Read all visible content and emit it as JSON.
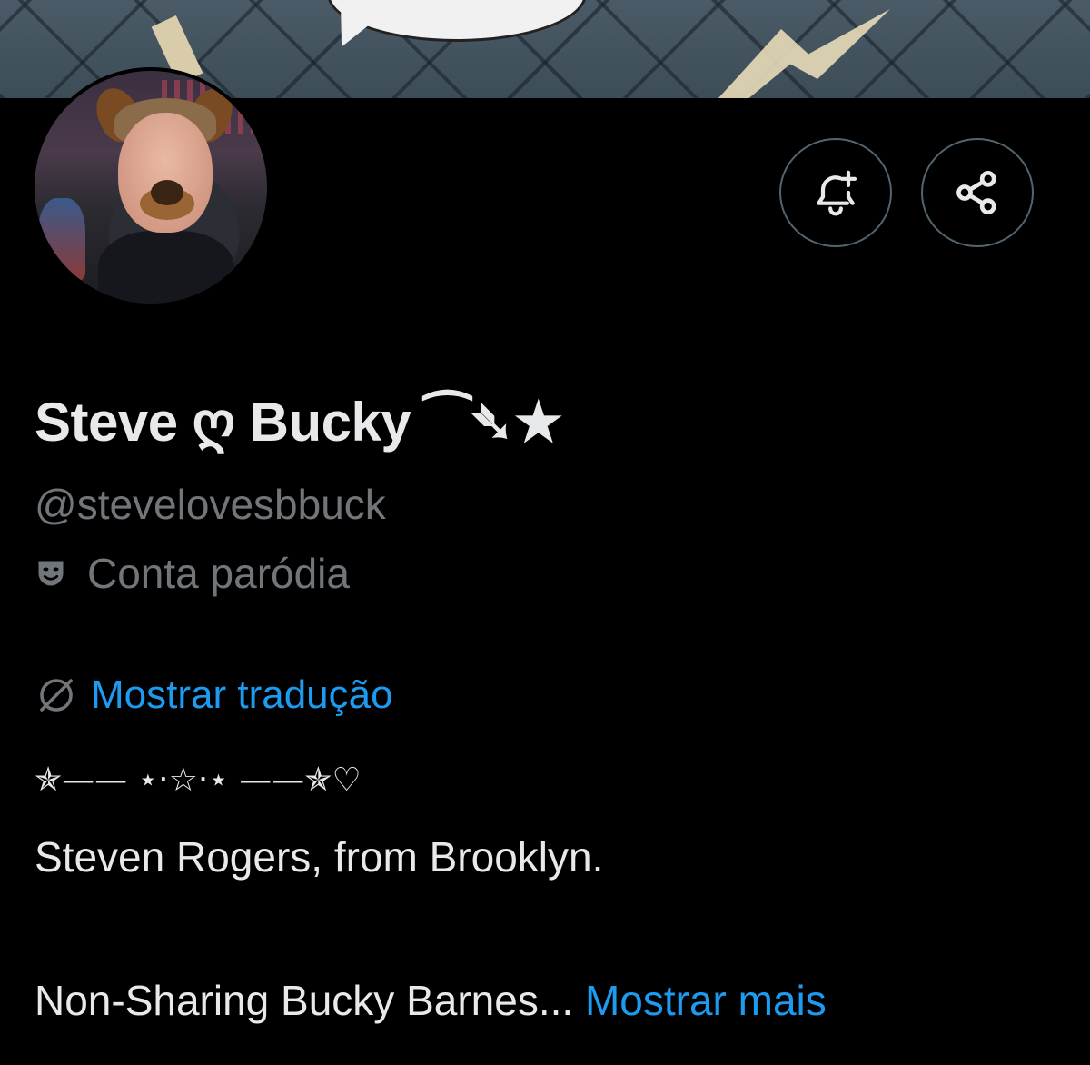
{
  "profile": {
    "display_name": "Steve ღ Bucky ⁀➴★",
    "handle": "@stevelovesbbuck",
    "parody_label": "Conta paródia",
    "translate_label": "Mostrar tradução",
    "bio_decor": "✯—— ⋆⋅☆⋅⋆ ——✯♡",
    "bio_line1": "Steven Rogers, from Brooklyn.",
    "bio_line2": "Non-Sharing Bucky Barnes...",
    "show_more_label": "Mostrar mais"
  },
  "actions": {
    "notify_icon": "bell-plus-icon",
    "share_icon": "share-icon"
  },
  "colors": {
    "background": "#000000",
    "text_primary": "#e7e9ea",
    "text_secondary": "#71767b",
    "link": "#1d9bf0",
    "border": "#536471"
  }
}
